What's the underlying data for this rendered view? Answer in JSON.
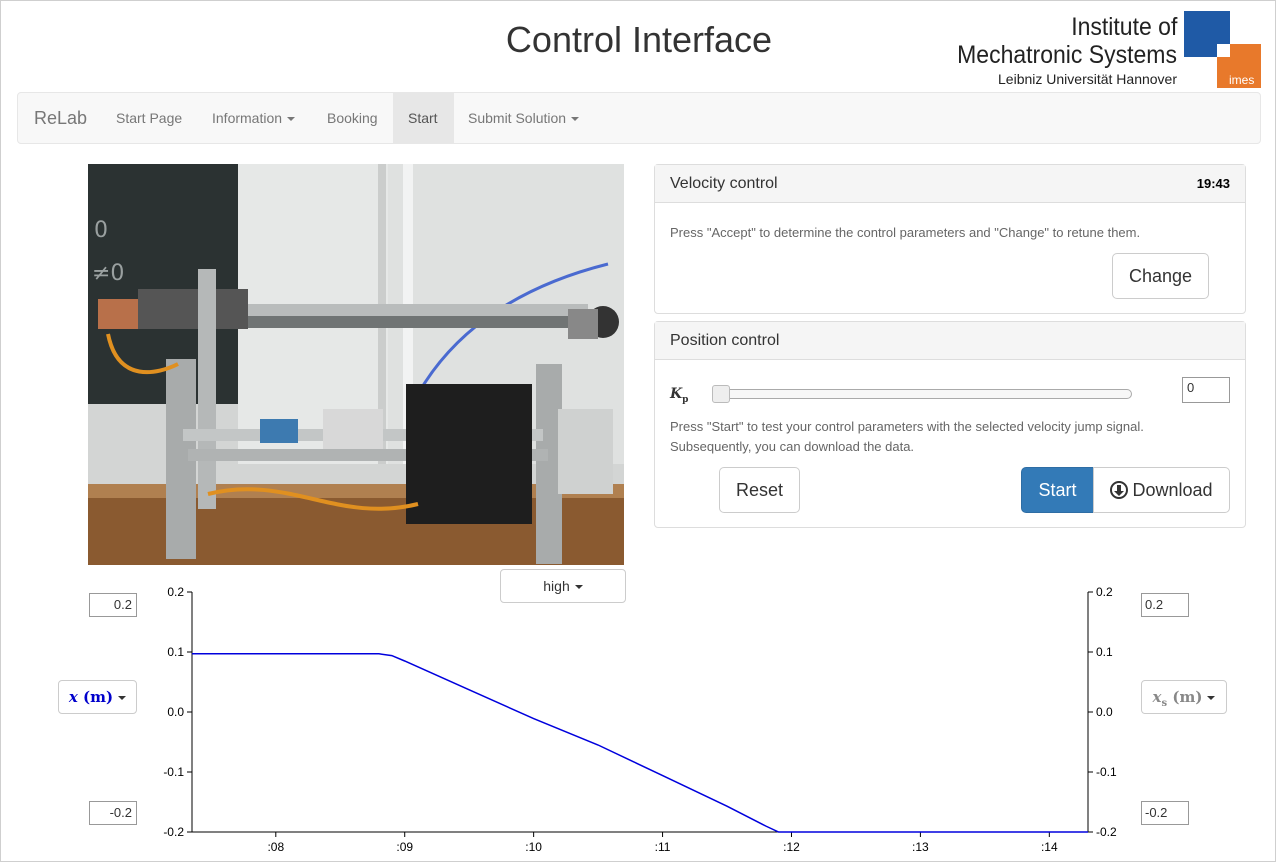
{
  "header": {
    "title": "Control Interface",
    "logo": {
      "line1": "Institute of",
      "line2": "Mechatronic Systems",
      "line3": "Leibniz Universität Hannover",
      "mark": "imes"
    }
  },
  "navbar": {
    "brand": "ReLab",
    "items": [
      {
        "label": "Start Page"
      },
      {
        "label": "Information"
      },
      {
        "label": "Booking"
      },
      {
        "label": "Start"
      },
      {
        "label": "Submit Solution"
      }
    ]
  },
  "velocity_panel": {
    "title": "Velocity control",
    "timer": "19:43",
    "text": "Press \"Accept\" to determine the control parameters and \"Change\" to retune them.",
    "change_label": "Change"
  },
  "position_panel": {
    "title": "Position control",
    "kp_symbol": "K",
    "kp_sub": "p",
    "kp_value": "0",
    "text_line1": "Press \"Start\" to test your control parameters with the selected velocity jump signal.",
    "text_line2": "Subsequently, you can download the data.",
    "reset_label": "Reset",
    "start_label": "Start",
    "download_label": "Download"
  },
  "video_quality": "high",
  "left_axis": {
    "max": "0.2",
    "min": "-0.2",
    "var": "x",
    "unit": "(m)",
    "color": "#0000cc"
  },
  "right_axis": {
    "max": "0.2",
    "min": "-0.2",
    "var": "x",
    "sub": "s",
    "unit": "(m)",
    "color": "#888888"
  },
  "chart_data": {
    "type": "line",
    "y_ticks": [
      "0.2",
      "0.1",
      "0.0",
      "-0.1",
      "-0.2"
    ],
    "y_tick_values": [
      0.2,
      0.1,
      0.0,
      -0.1,
      -0.2
    ],
    "x_ticks": [
      ":08",
      ":09",
      ":10",
      ":11",
      ":12",
      ":13",
      ":14"
    ],
    "x_tick_values": [
      8,
      9,
      10,
      11,
      12,
      13,
      14
    ],
    "xlim": [
      7.35,
      14.3
    ],
    "ylim": [
      -0.2,
      0.2
    ],
    "series": [
      {
        "color": "#0000dd",
        "x": [
          7.35,
          8.4,
          8.8,
          8.9,
          9.0,
          9.5,
          10.0,
          10.5,
          11.0,
          11.5,
          11.8,
          11.9,
          12.0,
          13.0,
          14.3
        ],
        "y": [
          0.097,
          0.097,
          0.097,
          0.094,
          0.085,
          0.037,
          -0.011,
          -0.055,
          -0.106,
          -0.157,
          -0.19,
          -0.2,
          -0.2,
          -0.2,
          -0.2
        ]
      }
    ]
  }
}
